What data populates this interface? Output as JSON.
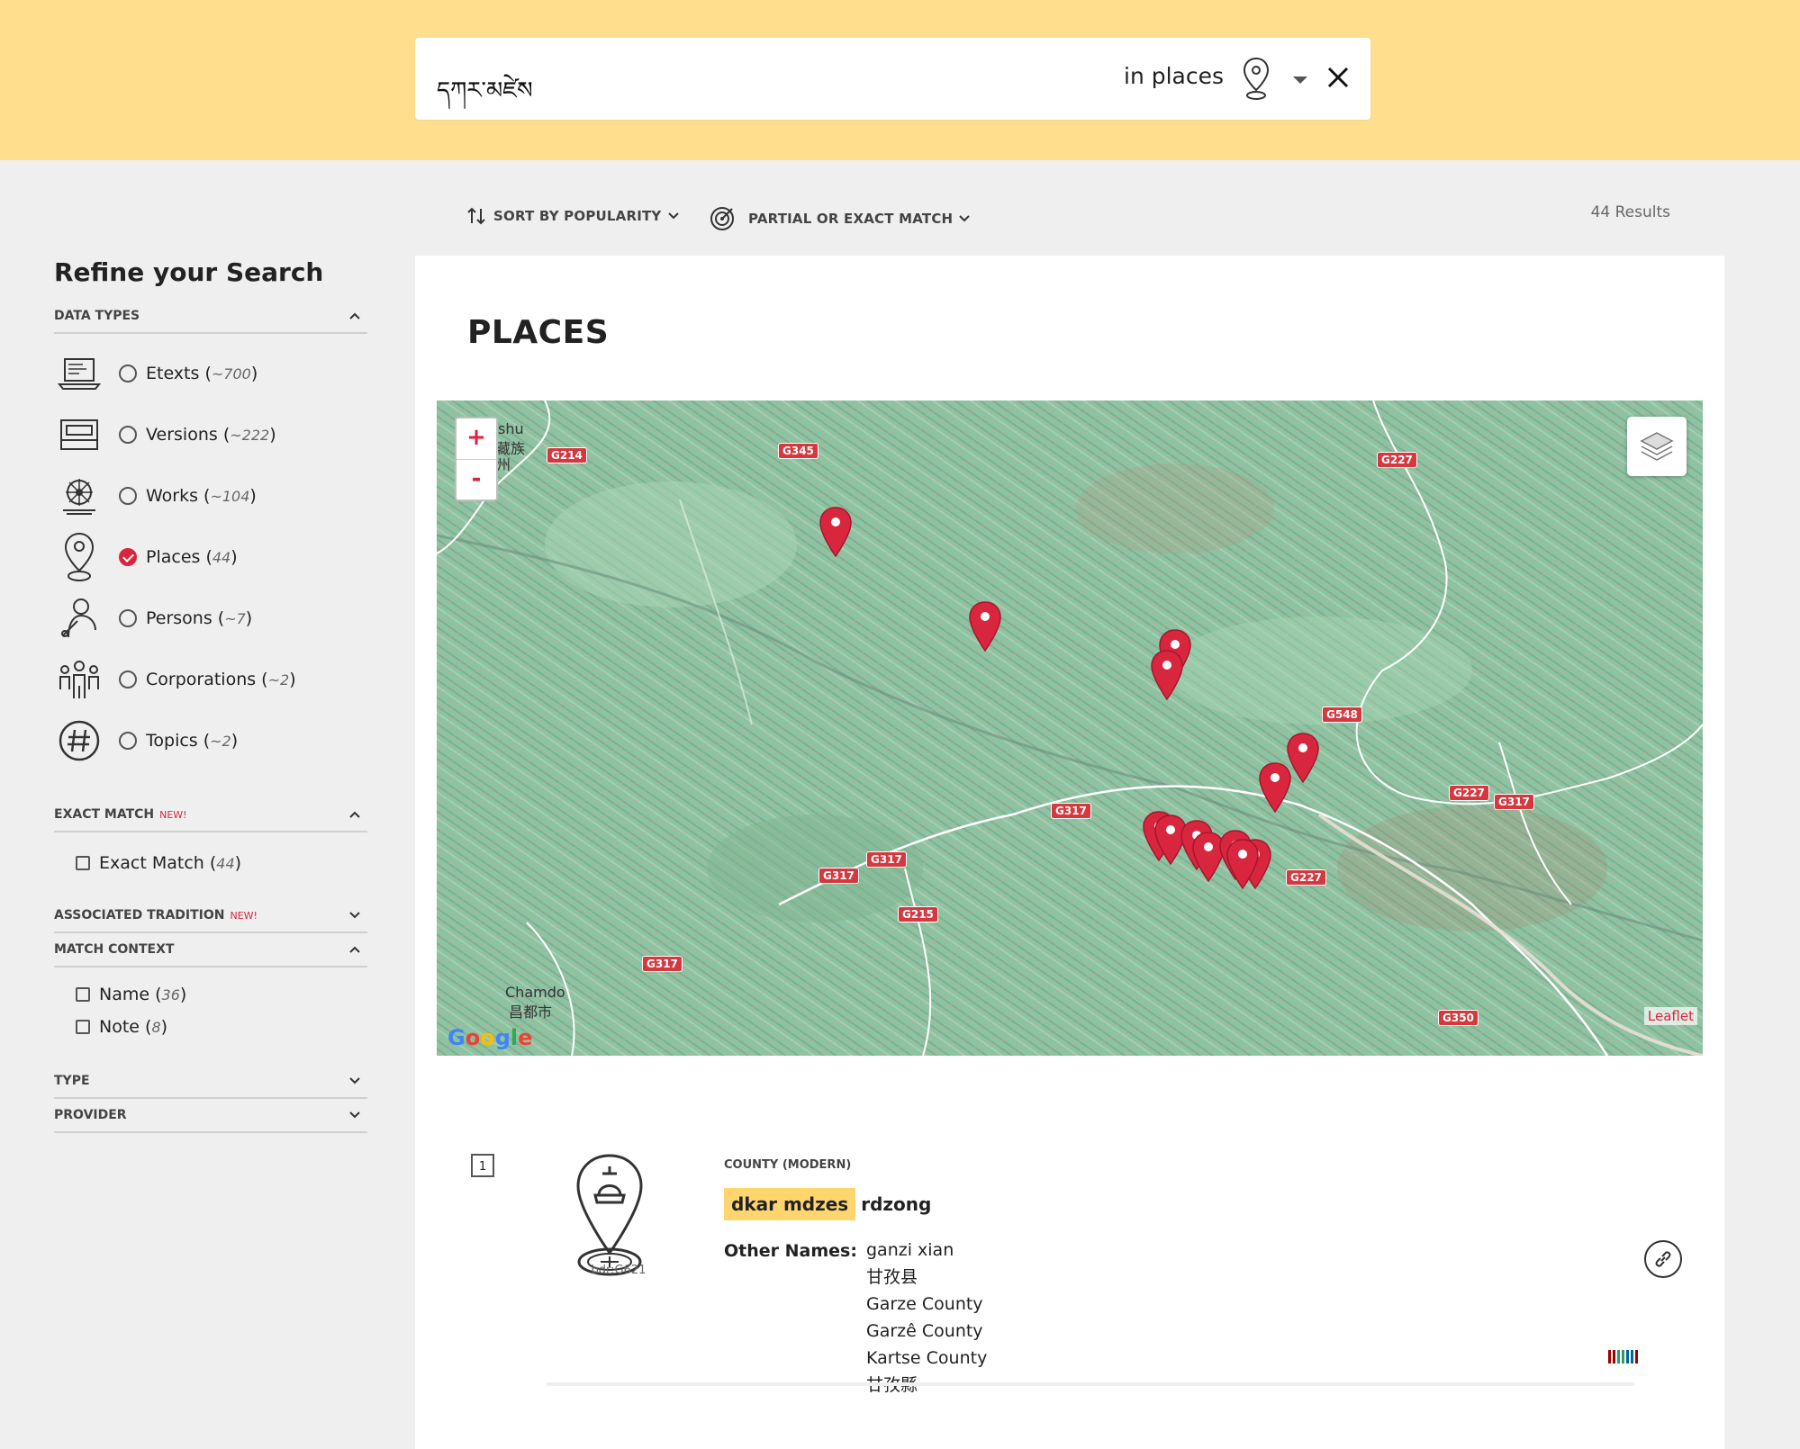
{
  "search": {
    "query": "དཀར་མཛེས",
    "scope": "in places"
  },
  "toolbar": {
    "sort_label": "SORT BY POPULARITY",
    "match_label": "PARTIAL OR EXACT MATCH",
    "results_count": "44 Results"
  },
  "sidebar": {
    "title": "Refine your Search",
    "data_types": {
      "heading": "DATA TYPES",
      "items": [
        {
          "label": "Etexts",
          "count": "~700",
          "selected": false,
          "icon": "etext-laptop-icon"
        },
        {
          "label": "Versions",
          "count": "~222",
          "selected": false,
          "icon": "versions-box-icon"
        },
        {
          "label": "Works",
          "count": "~104",
          "selected": false,
          "icon": "works-dharma-wheel-icon"
        },
        {
          "label": "Places",
          "count": "44",
          "selected": true,
          "icon": "places-pin-icon"
        },
        {
          "label": "Persons",
          "count": "~7",
          "selected": false,
          "icon": "persons-monk-icon"
        },
        {
          "label": "Corporations",
          "count": "~2",
          "selected": false,
          "icon": "corporations-people-icon"
        },
        {
          "label": "Topics",
          "count": "~2",
          "selected": false,
          "icon": "topics-hashtag-icon"
        }
      ]
    },
    "exact_match": {
      "heading": "EXACT MATCH",
      "badge": "NEW!",
      "option_label": "Exact Match",
      "option_count": "44"
    },
    "associated_tradition": {
      "heading": "ASSOCIATED TRADITION",
      "badge": "NEW!"
    },
    "match_context": {
      "heading": "MATCH CONTEXT",
      "options": [
        {
          "label": "Name",
          "count": "36"
        },
        {
          "label": "Note",
          "count": "8"
        }
      ]
    },
    "type_heading": "TYPE",
    "provider_heading": "PROVIDER"
  },
  "panel": {
    "title": "PLACES"
  },
  "map": {
    "zoom_in": "+",
    "zoom_out": "-",
    "attribution": "Leaflet",
    "google_logo": "Google",
    "place_labels": {
      "chamdo_en": "Chamdo",
      "chamdo_zh": "昌都市",
      "shu": "shu",
      "zangzu": "藏族",
      "zhou": "州"
    },
    "highways": [
      "G214",
      "G345",
      "G227",
      "G548",
      "G227",
      "G317",
      "G317",
      "G317",
      "G317",
      "G215",
      "G317",
      "G227",
      "G350"
    ],
    "marker_color": "#d9263f"
  },
  "result": {
    "number": "1",
    "id": "bdr:G621",
    "type": "COUNTY (MODERN)",
    "title_highlight": "dkar mdzes",
    "title_rest": "rdzong",
    "other_names_label": "Other Names:",
    "other_names": [
      "ganzi xian",
      "甘孜县",
      "Garze County",
      "Garzê County",
      "Kartse County",
      "甘孜縣"
    ]
  },
  "colors": {
    "top_band": "#ffdf8e",
    "accent_red": "#d9263f",
    "highlight": "#ffd56e"
  }
}
